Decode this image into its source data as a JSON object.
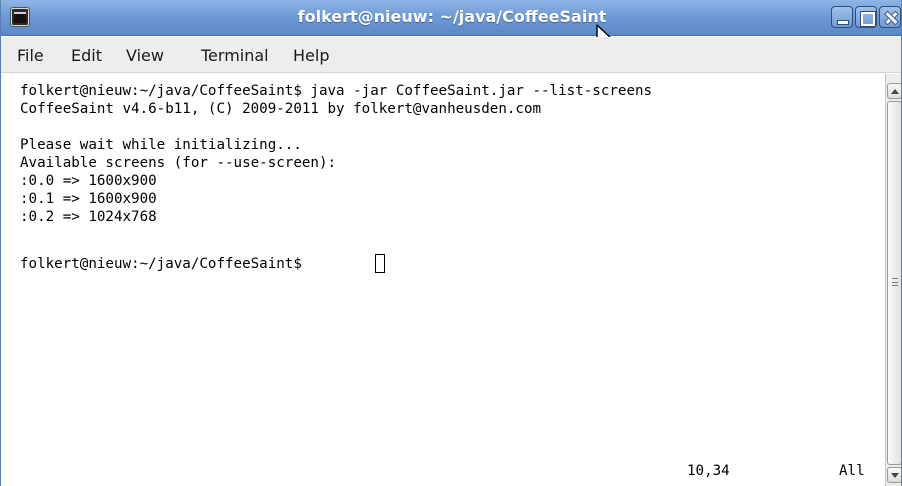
{
  "window": {
    "title": "folkert@nieuw: ~/java/CoffeeSaint",
    "icon": "terminal-app-icon",
    "controls": [
      "minimize-icon",
      "maximize-icon",
      "close-icon"
    ]
  },
  "menu": {
    "file": "File",
    "edit": "Edit",
    "view": "View",
    "terminal": "Terminal",
    "help": "Help"
  },
  "terminal": {
    "lines": [
      "folkert@nieuw:~/java/CoffeeSaint$ java -jar CoffeeSaint.jar --list-screens",
      "CoffeeSaint v4.6-b11, (C) 2009-2011 by folkert@vanheusden.com",
      "",
      "Please wait while initializing...",
      "Available screens (for --use-screen):",
      ":0.0 => 1600x900",
      ":0.1 => 1600x900",
      ":0.2 => 1024x768",
      "",
      "folkert@nieuw:~/java/CoffeeSaint$"
    ],
    "status_position": "10,34",
    "status_scope": "All"
  },
  "colors": {
    "titlebar": "#6f9bd6",
    "menubar": "#ededed",
    "terminal_bg": "#ffffff",
    "terminal_fg": "#000000"
  }
}
